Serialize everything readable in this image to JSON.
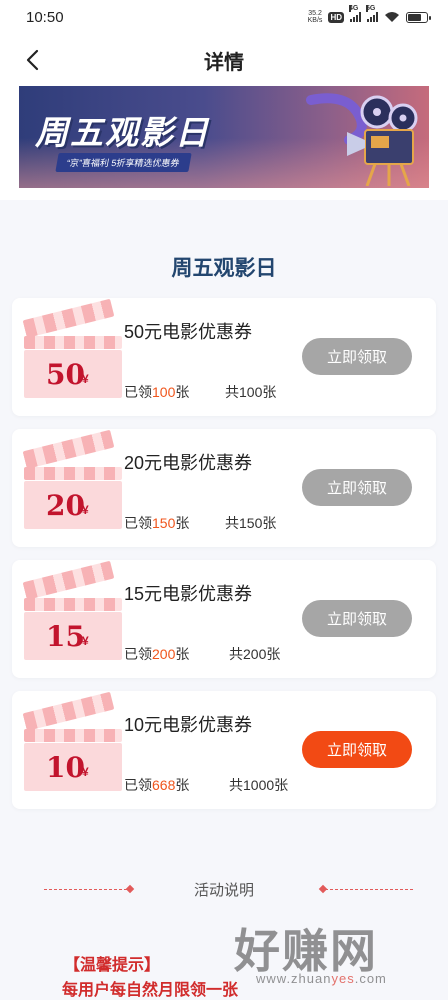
{
  "status": {
    "time": "10:50",
    "speed_value": "35.2",
    "speed_unit": "KB/s",
    "hd": "HD",
    "net1": "4G",
    "net2": "5G"
  },
  "nav": {
    "title": "详情"
  },
  "banner": {
    "title": "周五观影日",
    "subtitle": "“京”喜福利 5折享精选优惠券"
  },
  "section_title": "周五观影日",
  "coupons": [
    {
      "amount": "50",
      "unit": "¥",
      "name": "50元电影优惠券",
      "claimed_prefix": "已领",
      "claimed": "100",
      "claimed_suffix": "张",
      "total": "共100张",
      "button": "立即领取",
      "state": "gray"
    },
    {
      "amount": "20",
      "unit": "¥",
      "name": "20元电影优惠券",
      "claimed_prefix": "已领",
      "claimed": "150",
      "claimed_suffix": "张",
      "total": "共150张",
      "button": "立即领取",
      "state": "gray"
    },
    {
      "amount": "15",
      "unit": "¥",
      "name": "15元电影优惠券",
      "claimed_prefix": "已领",
      "claimed": "200",
      "claimed_suffix": "张",
      "total": "共200张",
      "button": "立即领取",
      "state": "gray"
    },
    {
      "amount": "10",
      "unit": "¥",
      "name": "10元电影优惠券",
      "claimed_prefix": "已领",
      "claimed": "668",
      "claimed_suffix": "张",
      "total": "共1000张",
      "button": "立即领取",
      "state": "active"
    }
  ],
  "activity_label": "活动说明",
  "tips": {
    "title": "【温馨提示】",
    "line1": "每用户每自然月限领一张"
  },
  "watermark": {
    "text": "好赚网",
    "url_pre": "www.zhuan",
    "url_hl": "yes",
    "url_post": ".com"
  },
  "colors": {
    "accent": "#f24a14",
    "claimed_number": "#f0561d",
    "disabled_button": "#a6a6a6",
    "section_title": "#23466f",
    "tip_red": "#d12c2c"
  }
}
